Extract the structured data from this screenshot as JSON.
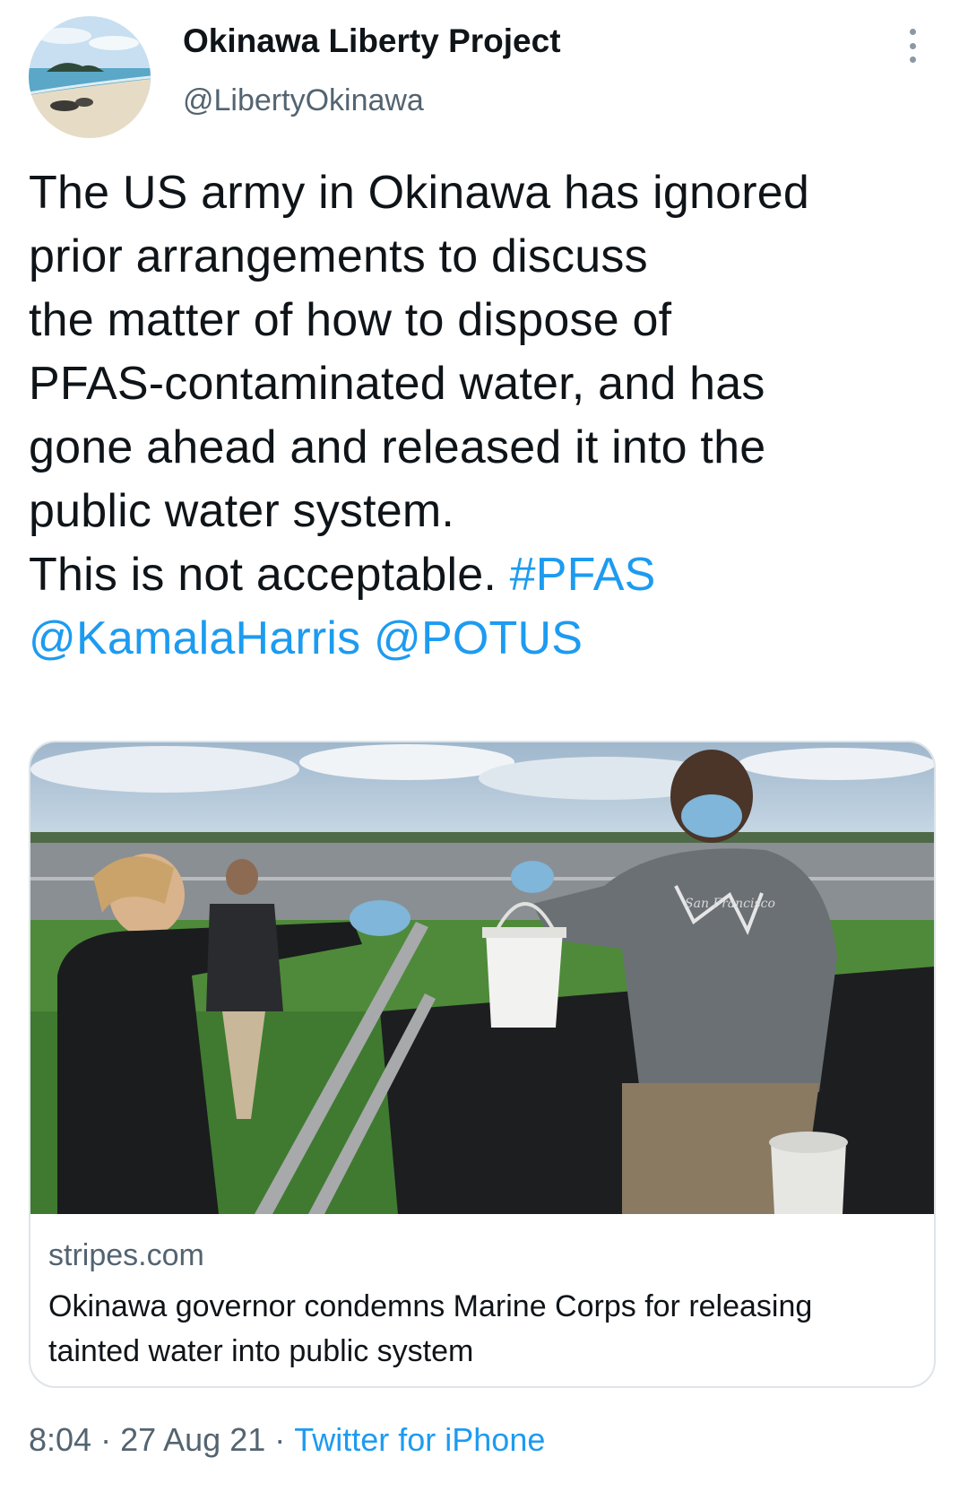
{
  "author": {
    "display_name": "Okinawa Liberty Project",
    "handle": "@LibertyOkinawa",
    "avatar_icon": "beach-island-avatar"
  },
  "more_icon": "more-vertical-icon",
  "tweet": {
    "lines": [
      "The US army in Okinawa has ignored",
      "prior arrangements to discuss",
      "the matter of how to dispose of",
      "PFAS-contaminated water, and has",
      "gone ahead and released it into the",
      "public water system."
    ],
    "last_line_text": "This is not acceptable.",
    "hashtag": "#PFAS",
    "mentions": [
      "@KamalaHarris",
      "@POTUS"
    ]
  },
  "card": {
    "domain": "stripes.com",
    "title": "Okinawa governor condemns Marine Corps for releasing tainted water into public system",
    "image_description_icon": "news-photo",
    "hoodie_print": "San Francisco"
  },
  "footer": {
    "time": "8:04",
    "date": "27 Aug 21",
    "separator": "·",
    "source": "Twitter for iPhone"
  },
  "colors": {
    "link": "#1d9bf0",
    "text": "#0f1419",
    "secondary": "#536471",
    "border": "#dfe4e8"
  }
}
